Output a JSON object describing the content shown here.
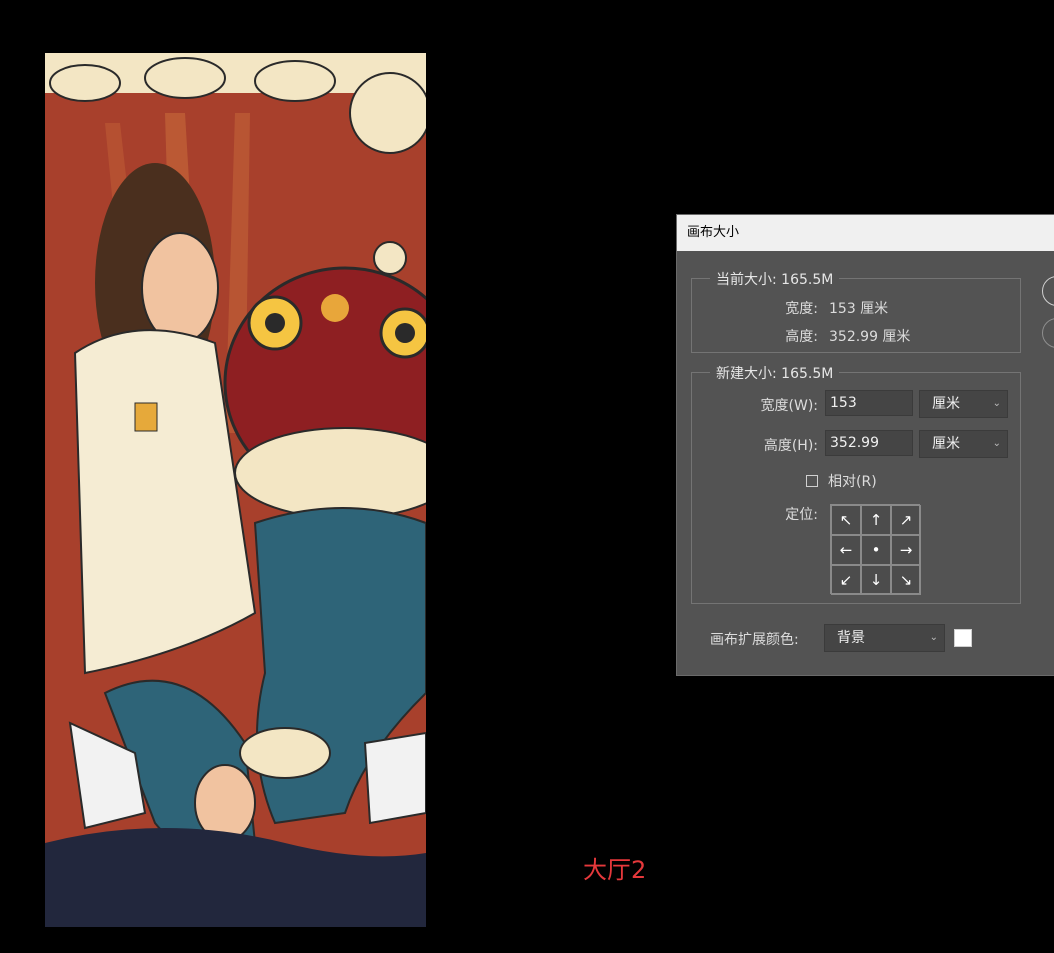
{
  "caption": "大厅2",
  "dialog": {
    "title": "画布大小",
    "current_size": {
      "legend": "当前大小: 165.5M",
      "width_label": "宽度:",
      "width_value": "153 厘米",
      "height_label": "高度:",
      "height_value": "352.99 厘米"
    },
    "new_size": {
      "legend": "新建大小: 165.5M",
      "width_label": "宽度(W):",
      "width_value": "153",
      "width_unit": "厘米",
      "height_label": "高度(H):",
      "height_value": "352.99",
      "height_unit": "厘米",
      "relative_label": "相对(R)",
      "relative_checked": false,
      "anchor_label": "定位:",
      "anchor_arrows": [
        "↖",
        "↑",
        "↗",
        "←",
        "•",
        "→",
        "↙",
        "↓",
        "↘"
      ]
    },
    "extension_color": {
      "label": "画布扩展颜色:",
      "value": "背景",
      "swatch_color": "#ffffff"
    }
  },
  "colors": {
    "background": "#000000",
    "dialog": "#535353",
    "caption": "#e5383b"
  }
}
